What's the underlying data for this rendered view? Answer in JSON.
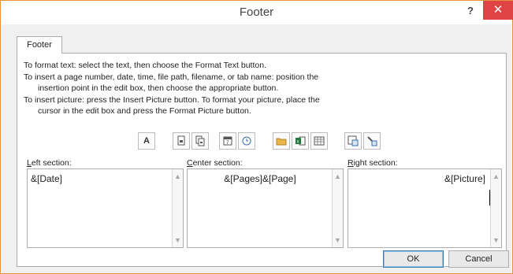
{
  "window": {
    "title": "Footer",
    "help_label": "?",
    "close_label": "✕"
  },
  "tabs": [
    {
      "label": "Footer"
    }
  ],
  "instructions": {
    "line1": "To format text:  select the text, then choose the Format Text button.",
    "line2": "To insert a page number, date, time, file path, filename, or tab name:  position the",
    "line3": "insertion point in the edit box, then choose the appropriate button.",
    "line4": "To insert picture: press the Insert Picture button.  To format your picture, place the",
    "line5": "cursor in the edit box and press the Format Picture button."
  },
  "toolbar": {
    "buttons": [
      {
        "name": "format-text-icon"
      },
      {
        "name": "insert-page-number-icon"
      },
      {
        "name": "insert-number-of-pages-icon"
      },
      {
        "name": "insert-date-icon"
      },
      {
        "name": "insert-time-icon"
      },
      {
        "name": "insert-file-path-icon"
      },
      {
        "name": "insert-file-name-icon"
      },
      {
        "name": "insert-sheet-name-icon"
      },
      {
        "name": "insert-picture-icon"
      },
      {
        "name": "format-picture-icon"
      }
    ],
    "format_text_glyph": "A"
  },
  "sections": {
    "left": {
      "label_prefix": "L",
      "label_rest": "eft section:",
      "value": "&[Date]"
    },
    "center": {
      "label_prefix": "C",
      "label_rest": "enter section:",
      "value": "&[Pages]&[Page]"
    },
    "right": {
      "label_prefix": "R",
      "label_rest": "ight section:",
      "value": "&[Picture]"
    }
  },
  "buttons": {
    "ok_label": "OK",
    "cancel_label": "Cancel"
  },
  "colors": {
    "accent_border": "#e8913a",
    "close_red": "#e04343"
  }
}
